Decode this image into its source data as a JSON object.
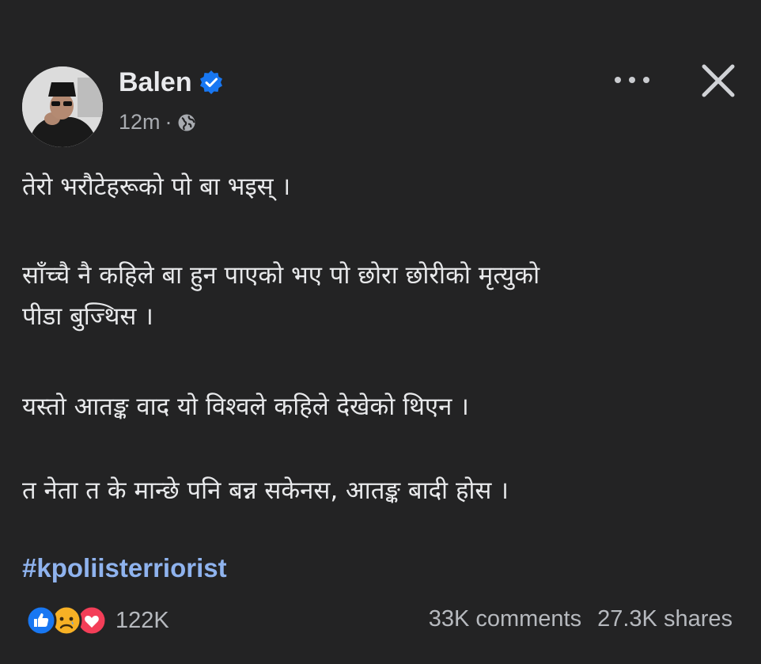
{
  "author": {
    "name": "Balen",
    "verified": true,
    "time": "12m",
    "separator": "·",
    "audience_icon": "globe-icon"
  },
  "header_actions": {
    "more_icon": "more-options-icon",
    "close_icon": "close-icon"
  },
  "post": {
    "paragraphs": [
      [
        "तेरो भरौटेहरूको पो बा भइस् ।"
      ],
      [
        "साँच्चै नै कहिले बा हुन पाएको  भए पो छोरा छोरीको मृत्युको",
        "पीडा बुज्थिस ।"
      ],
      [
        "यस्तो आतङ्क वाद यो विश्वले कहिले देखेको थिएन ।"
      ],
      [
        "त नेता त के मान्छे पनि बन्न सकेनस, आतङ्क बादी होस ।"
      ]
    ],
    "hashtag": "#kpoliisterriorist"
  },
  "engagement": {
    "reaction_icons": [
      "like-reaction-icon",
      "sad-reaction-icon",
      "love-reaction-icon"
    ],
    "reaction_count": "122K",
    "comments": "33K comments",
    "shares": "27.3K shares"
  },
  "colors": {
    "background": "#232324",
    "text": "#e8e9eb",
    "muted": "#a8abb0",
    "hashtag": "#8fb3ee",
    "verified_badge": "#1877f2",
    "like": "#1877f2",
    "sad": "#f7b125",
    "love": "#f33e58"
  }
}
